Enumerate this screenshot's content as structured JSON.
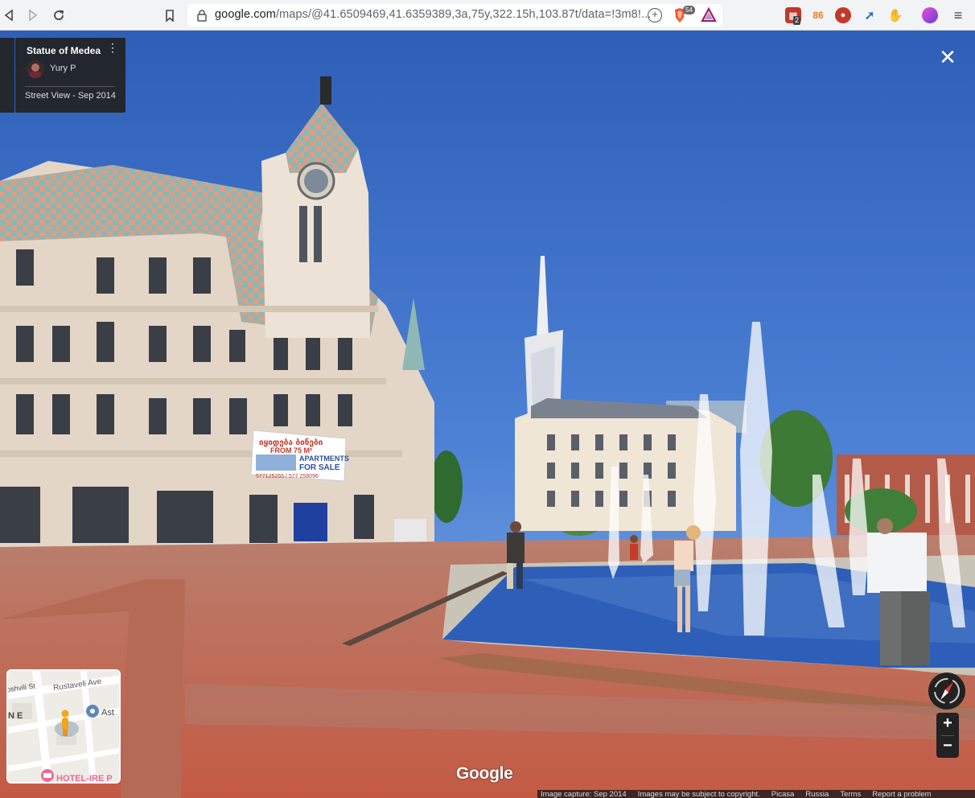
{
  "browser": {
    "url_domain": "google.com",
    "url_path": "/maps/@41.6509469,41.6359389,3a,75y,322.15h,103.87t/data=!3m8!...",
    "brave_shield_count": "54",
    "extension_badge": "2",
    "extension_badge_2": "86"
  },
  "info_card": {
    "title": "Statue of Medea",
    "author": "Yury P",
    "date": "Street View - Sep 2014"
  },
  "scene": {
    "banner_line1": "იყიდება ბინები",
    "banner_line2": "FROM 75 M²",
    "banner_line3": "APARTMENTS",
    "banner_line4": "FOR SALE",
    "banner_phone": "577125255 / 577 258096"
  },
  "minimap": {
    "street1": "Rustaveli Ave",
    "street2": "oshvili St",
    "place1": "Ast",
    "place2": "HOTEL-IRE P",
    "corner": "N E"
  },
  "controls": {
    "close_glyph": "✕",
    "zoom_in": "+",
    "zoom_out": "−",
    "menu_glyph": "⋮"
  },
  "branding": {
    "logo": "Google"
  },
  "footer": {
    "capture": "Image capture: Sep 2014",
    "copyright": "Images may be subject to copyright.",
    "provider": "Picasa",
    "region": "Russia",
    "terms": "Terms",
    "report": "Report a problem"
  }
}
